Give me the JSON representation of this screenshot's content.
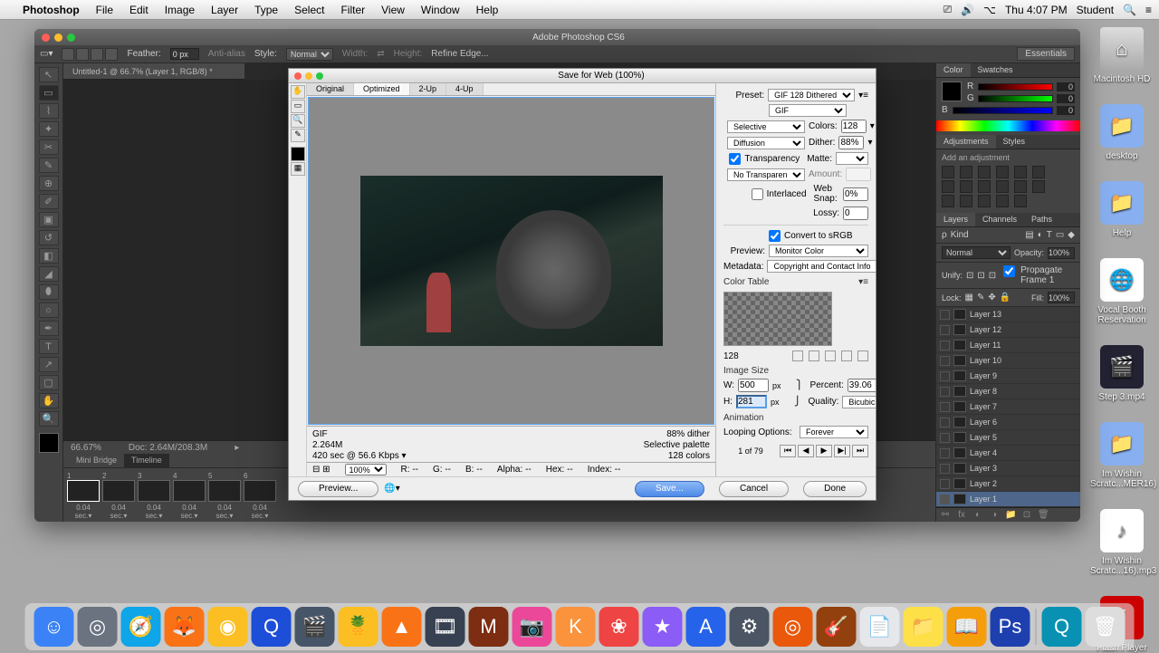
{
  "menubar": {
    "app": "Photoshop",
    "items": [
      "File",
      "Edit",
      "Image",
      "Layer",
      "Type",
      "Select",
      "Filter",
      "View",
      "Window",
      "Help"
    ],
    "right": {
      "time": "Thu 4:07 PM",
      "user": "Student"
    }
  },
  "desktop": [
    {
      "label": "Macintosh HD",
      "cls": "hd"
    },
    {
      "label": "desktop",
      "cls": ""
    },
    {
      "label": "Help",
      "cls": ""
    },
    {
      "label": "Vocal Booth Reservation",
      "cls": ""
    },
    {
      "label": "Step 3.mp4",
      "cls": ""
    },
    {
      "label": "Im Wishin Scratc...MER16)",
      "cls": ""
    },
    {
      "label": "Im Wishin Scratc...16).mp3",
      "cls": "mp"
    },
    {
      "label": "Flash Player",
      "cls": ""
    }
  ],
  "ps": {
    "title": "Adobe Photoshop CS6",
    "tab": "Untitled-1 @ 66.7% (Layer 1, RGB/8) *",
    "workspace": "Essentials",
    "options": {
      "feather_label": "Feather:",
      "feather": "0 px",
      "aa": "Anti-alias",
      "style": "Style:",
      "style_v": "Normal",
      "width": "Width:",
      "height": "Height:",
      "refine": "Refine Edge..."
    },
    "status": {
      "zoom": "66.67%",
      "doc": "Doc: 2.64M/208.3M"
    },
    "timeline": {
      "tabs": [
        "Mini Bridge",
        "Timeline"
      ],
      "loop": "Forever",
      "frames": [
        {
          "n": "1",
          "t": "0.04 sec."
        },
        {
          "n": "2",
          "t": "0.04 sec."
        },
        {
          "n": "3",
          "t": "0.04 sec."
        },
        {
          "n": "4",
          "t": "0.04 sec."
        },
        {
          "n": "5",
          "t": "0.04 sec."
        },
        {
          "n": "6",
          "t": "0.04 sec."
        }
      ]
    }
  },
  "panels": {
    "color": {
      "tabs": [
        "Color",
        "Swatches"
      ],
      "r": "0",
      "g": "0",
      "b": "0"
    },
    "adj": {
      "tabs": [
        "Adjustments",
        "Styles"
      ],
      "hdr": "Add an adjustment"
    },
    "layers": {
      "tabs": [
        "Layers",
        "Channels",
        "Paths"
      ],
      "kind": "Kind",
      "mode": "Normal",
      "opacity_l": "Opacity:",
      "opacity": "100%",
      "unify": "Unify:",
      "propagate": "Propagate Frame 1",
      "lock": "Lock:",
      "fill_l": "Fill:",
      "fill": "100%",
      "items": [
        {
          "name": "Layer 13",
          "vis": false
        },
        {
          "name": "Layer 12",
          "vis": false
        },
        {
          "name": "Layer 11",
          "vis": false
        },
        {
          "name": "Layer 10",
          "vis": false
        },
        {
          "name": "Layer 9",
          "vis": false
        },
        {
          "name": "Layer 8",
          "vis": false
        },
        {
          "name": "Layer 7",
          "vis": false
        },
        {
          "name": "Layer 6",
          "vis": false
        },
        {
          "name": "Layer 5",
          "vis": false
        },
        {
          "name": "Layer 4",
          "vis": false
        },
        {
          "name": "Layer 3",
          "vis": false
        },
        {
          "name": "Layer 2",
          "vis": false
        },
        {
          "name": "Layer 1",
          "vis": true,
          "active": true
        }
      ]
    }
  },
  "sfw": {
    "title": "Save for Web (100%)",
    "tabs": [
      "Original",
      "Optimized",
      "2-Up",
      "4-Up"
    ],
    "info": {
      "fmt": "GIF",
      "size": "2.264M",
      "time": "420 sec @ 56.6 Kbps",
      "dither": "88% dither",
      "pal": "Selective palette",
      "colors": "128 colors"
    },
    "bar": {
      "zoom": "100%",
      "r": "R:",
      "g": "G:",
      "b": "B:",
      "a": "Alpha:",
      "hx": "Hex:",
      "ix": "Index:",
      "dash": "--"
    },
    "right": {
      "preset_l": "Preset:",
      "preset": "GIF 128 Dithered",
      "format": "GIF",
      "reduction": "Selective",
      "colors_l": "Colors:",
      "colors": "128",
      "dither_m": "Diffusion",
      "dither_l": "Dither:",
      "dither": "88%",
      "transparency": "Transparency",
      "matte_l": "Matte:",
      "td": "No Transparency Dither",
      "amount_l": "Amount:",
      "interlaced": "Interlaced",
      "websnap_l": "Web Snap:",
      "websnap": "0%",
      "lossy_l": "Lossy:",
      "lossy": "0",
      "srgb": "Convert to sRGB",
      "preview_l": "Preview:",
      "preview": "Monitor Color",
      "metadata_l": "Metadata:",
      "metadata": "Copyright and Contact Info",
      "ct_l": "Color Table",
      "ct_count": "128",
      "is_l": "Image Size",
      "w_l": "W:",
      "w": "500",
      "h_l": "H:",
      "h": "281",
      "px": "px",
      "percent_l": "Percent:",
      "percent": "39.06",
      "pct": "%",
      "quality_l": "Quality:",
      "quality": "Bicubic",
      "anim_l": "Animation",
      "loop_l": "Looping Options:",
      "loop": "Forever",
      "frame": "1 of 79"
    },
    "buttons": {
      "preview": "Preview...",
      "save": "Save...",
      "cancel": "Cancel",
      "done": "Done"
    }
  },
  "dock": [
    {
      "c": "#3b82f6",
      "g": "☺"
    },
    {
      "c": "#6b7280",
      "g": "◎"
    },
    {
      "c": "#0ea5e9",
      "g": "🧭"
    },
    {
      "c": "#f97316",
      "g": "🦊"
    },
    {
      "c": "#fbbf24",
      "g": "◉"
    },
    {
      "c": "#1d4ed8",
      "g": "Q"
    },
    {
      "c": "#475569",
      "g": "🎬"
    },
    {
      "c": "#fbbf24",
      "g": "🍍"
    },
    {
      "c": "#f97316",
      "g": "▲"
    },
    {
      "c": "#374151",
      "g": "🎞"
    },
    {
      "c": "#7c2d12",
      "g": "M"
    },
    {
      "c": "#ec4899",
      "g": "📷"
    },
    {
      "c": "#fb923c",
      "g": "K"
    },
    {
      "c": "#ef4444",
      "g": "❀"
    },
    {
      "c": "#8b5cf6",
      "g": "★"
    },
    {
      "c": "#2563eb",
      "g": "A"
    },
    {
      "c": "#4b5563",
      "g": "⚙"
    },
    {
      "c": "#ea580c",
      "g": "◎"
    },
    {
      "c": "#92400e",
      "g": "🎸"
    },
    {
      "c": "#e5e7eb",
      "g": "📄"
    },
    {
      "c": "#fde047",
      "g": "📁"
    },
    {
      "c": "#f59e0b",
      "g": "📖"
    },
    {
      "c": "#1e40af",
      "g": "Ps"
    },
    {
      "c": "#0891b2",
      "g": "Q"
    }
  ]
}
